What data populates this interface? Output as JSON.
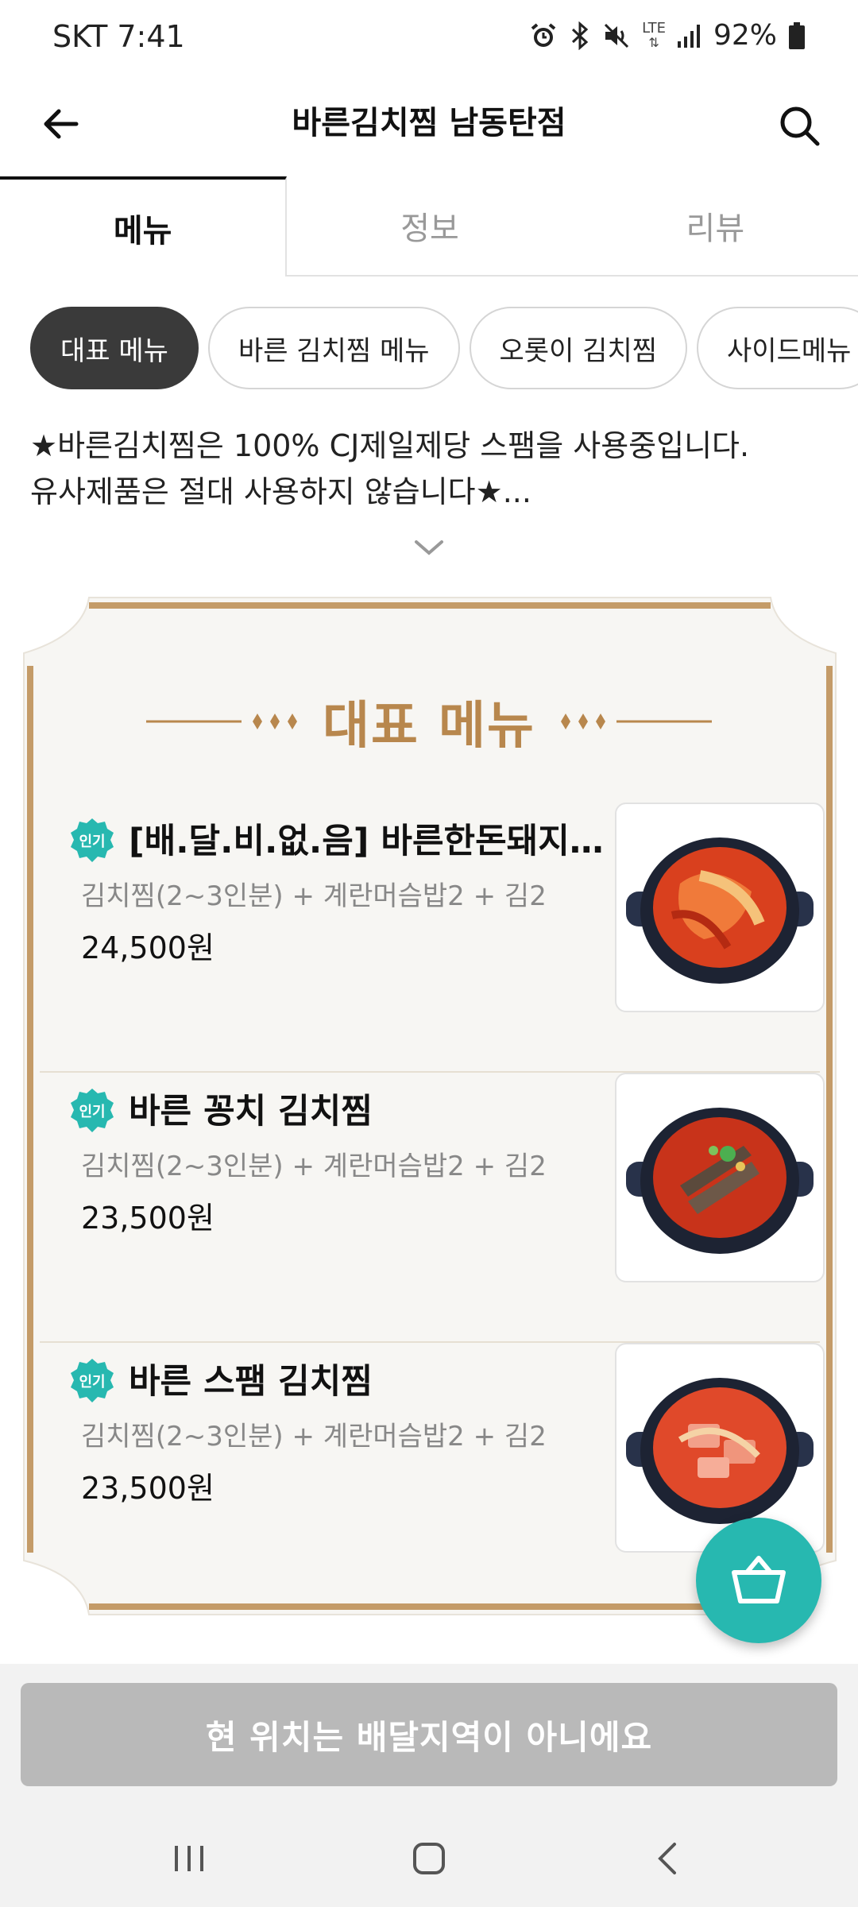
{
  "status_bar": {
    "carrier_time": "SKT 7:41",
    "network": "LTE",
    "battery": "92%",
    "icons": [
      "alarm-icon",
      "bluetooth-icon",
      "mute-icon",
      "lte-icon",
      "signal-icon",
      "battery-icon"
    ]
  },
  "header": {
    "title": "바른김치찜 남동탄점",
    "back_icon": "back-arrow-icon",
    "search_icon": "search-icon"
  },
  "tabs": [
    {
      "label": "메뉴",
      "active": true
    },
    {
      "label": "정보",
      "active": false
    },
    {
      "label": "리뷰",
      "active": false
    }
  ],
  "chips": [
    {
      "label": "대표 메뉴",
      "active": true
    },
    {
      "label": "바른 김치찜 메뉴",
      "active": false
    },
    {
      "label": "오롯이 김치찜",
      "active": false
    },
    {
      "label": "사이드메뉴",
      "active": false
    }
  ],
  "notice": {
    "line1": "★바른김치찜은 100% CJ제일제당 스팸을 사용중입니다.",
    "line2": "유사제품은 절대 사용하지 않습니다★...",
    "expand_icon": "chevron-down-icon"
  },
  "board": {
    "title": "대표 메뉴",
    "items": [
      {
        "badge": "인기",
        "name": "[배.달.비.없.음] 바른한돈돼지...",
        "desc": "김치찜(2~3인분) + 계란머슴밥2 + 김2",
        "price": "24,500원"
      },
      {
        "badge": "인기",
        "name": "바른 꽁치 김치찜",
        "desc": "김치찜(2~3인분) + 계란머슴밥2 + 김2",
        "price": "23,500원"
      },
      {
        "badge": "인기",
        "name": "바른 스팸 김치찜",
        "desc": "김치찜(2~3인분) + 계란머슴밥2 + 김2",
        "price": "23,500원"
      }
    ]
  },
  "cart_icon": "basket-icon",
  "delivery_button": "현 위치는 배달지역이 아니에요",
  "colors": {
    "accent_teal": "#27b8b0",
    "board_gold": "#b8874d",
    "chip_active": "#3a3a3a",
    "disabled_button": "#b9b9b9"
  },
  "navbar": [
    "recent-apps-icon",
    "home-icon",
    "nav-back-icon"
  ]
}
